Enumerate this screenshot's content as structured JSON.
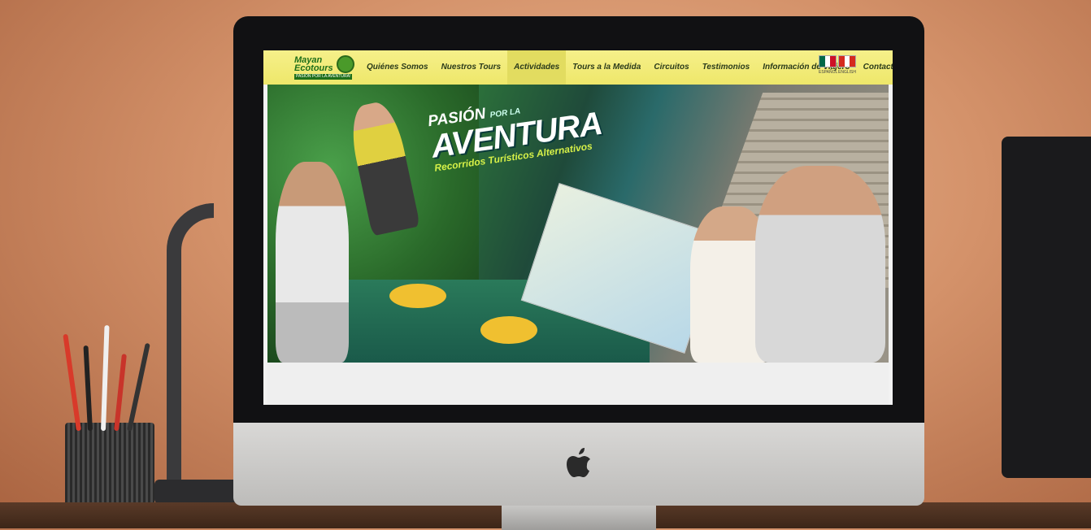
{
  "site": {
    "logo": {
      "line1": "Mayan",
      "line2": "Ecotours",
      "tagline": "PASIÓN POR LA AVENTURA!"
    },
    "nav": {
      "items": [
        {
          "label": "Quiénes Somos"
        },
        {
          "label": "Nuestros Tours"
        },
        {
          "label": "Actividades",
          "active": true
        },
        {
          "label": "Tours a la Medida"
        },
        {
          "label": "Circuitos"
        },
        {
          "label": "Testimonios"
        },
        {
          "label": "Información de Viajero"
        },
        {
          "label": "Contacto"
        }
      ]
    },
    "languages": [
      {
        "label": "ESPAÑOL",
        "flag_colors": [
          "#006847",
          "#ffffff",
          "#ce1126"
        ]
      },
      {
        "label": "ENGLISH",
        "flag_colors": [
          "#d52b1e",
          "#ffffff",
          "#d52b1e"
        ]
      }
    ],
    "hero": {
      "pre": "PASIÓN",
      "por": "POR LA",
      "main": "AVENTURA",
      "sub": "Recorridos Turísticos Alternativos"
    }
  },
  "device": {
    "apple_logo": ""
  },
  "colors": {
    "nav_bg": "#f2ec7a",
    "brand_green": "#1f6f1a",
    "hero_subtitle": "#d6f048"
  }
}
